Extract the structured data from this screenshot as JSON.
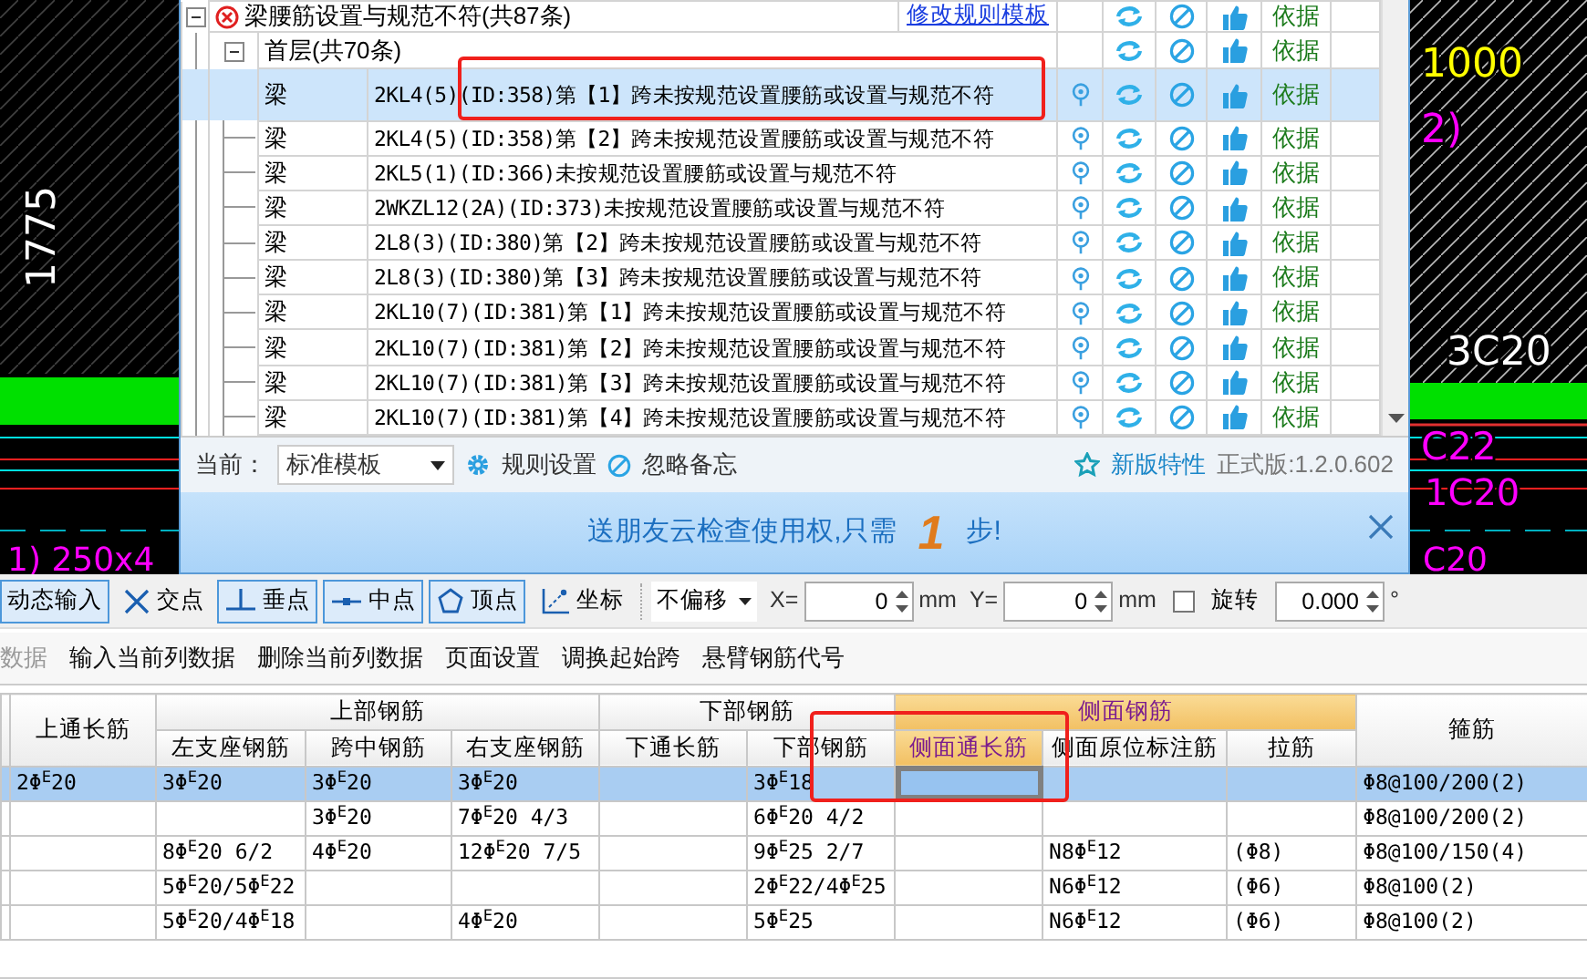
{
  "cad_labels": [
    {
      "text": "1775",
      "color": "#ffffff"
    },
    {
      "text": "1000",
      "color": "#ffff00"
    },
    {
      "text": "2)",
      "color": "#ff00ff"
    },
    {
      "text": "3C20",
      "color": "#ffffff"
    },
    {
      "text": "C22",
      "color": "#ff00ff"
    },
    {
      "text": "1C20",
      "color": "#ff00ff"
    },
    {
      "text": "1) 250x4",
      "color": "#ff00ff"
    },
    {
      "text": "C20",
      "color": "#ff00ff"
    }
  ],
  "check_dialog": {
    "rule_group": {
      "title": "梁腰筋设置与规范不符(共87条)",
      "expanded": true,
      "edit_link": "修改规则模板",
      "basis": "依据",
      "floors": [
        {
          "title": "首层(共70条)",
          "expanded": true,
          "basis": "依据",
          "issues": [
            {
              "type": "梁",
              "description": "2KL4(5)(ID:358)第【1】跨未按规范设置腰筋或设置与规范不符",
              "basis": "依据",
              "selected": true
            },
            {
              "type": "梁",
              "description": "2KL4(5)(ID:358)第【2】跨未按规范设置腰筋或设置与规范不符",
              "basis": "依据",
              "selected": false
            },
            {
              "type": "梁",
              "description": "2KL5(1)(ID:366)未按规范设置腰筋或设置与规范不符",
              "basis": "依据",
              "selected": false
            },
            {
              "type": "梁",
              "description": "2WKZL12(2A)(ID:373)未按规范设置腰筋或设置与规范不符",
              "basis": "依据",
              "selected": false
            },
            {
              "type": "梁",
              "description": "2L8(3)(ID:380)第【2】跨未按规范设置腰筋或设置与规范不符",
              "basis": "依据",
              "selected": false
            },
            {
              "type": "梁",
              "description": "2L8(3)(ID:380)第【3】跨未按规范设置腰筋或设置与规范不符",
              "basis": "依据",
              "selected": false
            },
            {
              "type": "梁",
              "description": "2KL10(7)(ID:381)第【1】跨未按规范设置腰筋或设置与规范不符",
              "basis": "依据",
              "selected": false
            },
            {
              "type": "梁",
              "description": "2KL10(7)(ID:381)第【2】跨未按规范设置腰筋或设置与规范不符",
              "basis": "依据",
              "selected": false
            },
            {
              "type": "梁",
              "description": "2KL10(7)(ID:381)第【3】跨未按规范设置腰筋或设置与规范不符",
              "basis": "依据",
              "selected": false
            },
            {
              "type": "梁",
              "description": "2KL10(7)(ID:381)第【4】跨未按规范设置腰筋或设置与规范不符",
              "basis": "依据",
              "selected": false
            }
          ]
        }
      ]
    },
    "footer": {
      "template_label": "当前：",
      "template": "标准模板",
      "rule_settings": "规则设置",
      "ignore_memo": "忽略备忘",
      "new_features": "新版特性",
      "version": "正式版:1.2.0.602"
    },
    "banner": {
      "text_before": "送朋友云检查使用权,只需",
      "highlight": "1",
      "text_after": "步!"
    }
  },
  "toolbar": [
    {
      "kind": "toggle",
      "label": "动态输入",
      "selected": true
    },
    {
      "kind": "snap",
      "label": "交点",
      "selected": false
    },
    {
      "kind": "snap",
      "label": "垂点",
      "selected": true
    },
    {
      "kind": "snap",
      "label": "中点",
      "selected": true
    },
    {
      "kind": "snap",
      "label": "顶点",
      "selected": true
    },
    {
      "kind": "snap",
      "label": "坐标",
      "selected": false
    },
    {
      "kind": "dropdown",
      "value": "不偏移"
    },
    {
      "kind": "spin",
      "label": "X=",
      "value": "0",
      "unit": "mm"
    },
    {
      "kind": "spin",
      "label": "Y=",
      "value": "0",
      "unit": "mm"
    },
    {
      "kind": "checkbox",
      "label": "旋转",
      "checked": false
    },
    {
      "kind": "spin",
      "value": "0.000",
      "unit": "°"
    }
  ],
  "menu": [
    {
      "label": "数据",
      "disabled": true
    },
    {
      "label": "输入当前列数据",
      "disabled": false
    },
    {
      "label": "删除当前列数据",
      "disabled": false
    },
    {
      "label": "页面设置",
      "disabled": false
    },
    {
      "label": "调换起始跨",
      "disabled": false
    },
    {
      "label": "悬臂钢筋代号",
      "disabled": false
    }
  ],
  "rebar_table": {
    "header": [
      {
        "label": "上通长筋"
      },
      {
        "label": "上部钢筋",
        "subcolumns": [
          {
            "label": "左支座钢筋",
            "selected": false
          },
          {
            "label": "跨中钢筋",
            "selected": false
          },
          {
            "label": "右支座钢筋",
            "selected": false
          }
        ]
      },
      {
        "label": "下部钢筋",
        "subcolumns": [
          {
            "label": "下通长筋",
            "selected": false
          },
          {
            "label": "下部钢筋",
            "selected": false
          }
        ]
      },
      {
        "label": "侧面钢筋",
        "subcolumns": [
          {
            "label": "侧面通长筋",
            "selected": true
          },
          {
            "label": "侧面原位标注筋",
            "selected": false
          },
          {
            "label": "拉筋",
            "selected": false
          }
        ]
      },
      {
        "label": "箍筋"
      }
    ],
    "rows": [
      {
        "selected": true,
        "cells": [
          {
            "text": "2Φ$^{E}$20",
            "active": false
          },
          {
            "text": "3Φ$^{E}$20",
            "active": false
          },
          {
            "text": "3Φ$^{E}$20",
            "active": false
          },
          {
            "text": "3Φ$^{E}$20",
            "active": false
          },
          {
            "active": false
          },
          {
            "text": "3Φ$^{E}$18",
            "active": false
          },
          {
            "active": true
          },
          {
            "active": false
          },
          {
            "active": false
          },
          {
            "text": "Φ8@100/200(2)",
            "active": false
          }
        ]
      },
      {
        "selected": false,
        "cells": [
          {
            "active": false
          },
          {
            "active": false
          },
          {
            "text": "3Φ$^{E}$20",
            "active": false
          },
          {
            "text": "7Φ$^{E}$20 4/3",
            "active": false
          },
          {
            "active": false
          },
          {
            "text": "6Φ$^{E}$20 4/2",
            "active": false
          },
          {
            "active": false
          },
          {
            "active": false
          },
          {
            "active": false
          },
          {
            "text": "Φ8@100/200(2)",
            "active": false
          }
        ]
      },
      {
        "selected": false,
        "cells": [
          {
            "active": false
          },
          {
            "text": "8Φ$^{E}$20 6/2",
            "active": false
          },
          {
            "text": "4Φ$^{E}$20",
            "active": false
          },
          {
            "text": "12Φ$^{E}$20 7/5",
            "active": false
          },
          {
            "active": false
          },
          {
            "text": "9Φ$^{E}$25 2/7",
            "active": false
          },
          {
            "active": false
          },
          {
            "text": "N8Φ$^{E}$12",
            "active": false
          },
          {
            "text": "(Φ8)",
            "active": false
          },
          {
            "text": "Φ8@100/150(4)",
            "active": false
          }
        ]
      },
      {
        "selected": false,
        "cells": [
          {
            "active": false
          },
          {
            "text": "5Φ$^{E}$20/5Φ$^{E}$22",
            "active": false
          },
          {
            "active": false
          },
          {
            "active": false
          },
          {
            "active": false
          },
          {
            "text": "2Φ$^{E}$22/4Φ$^{E}$25",
            "active": false
          },
          {
            "active": false
          },
          {
            "text": "N6Φ$^{E}$12",
            "active": false
          },
          {
            "text": "(Φ6)",
            "active": false
          },
          {
            "text": "Φ8@100(2)",
            "active": false
          }
        ]
      },
      {
        "selected": false,
        "cells": [
          {
            "active": false
          },
          {
            "text": "5Φ$^{E}$20/4Φ$^{E}$18",
            "active": false
          },
          {
            "active": false
          },
          {
            "text": "4Φ$^{E}$20",
            "active": false
          },
          {
            "active": false
          },
          {
            "text": "5Φ$^{E}$25",
            "active": false
          },
          {
            "active": false
          },
          {
            "text": "N6Φ$^{E}$12",
            "active": false
          },
          {
            "text": "(Φ6)",
            "active": false
          },
          {
            "text": "Φ8@100(2)",
            "active": false
          }
        ]
      }
    ]
  }
}
